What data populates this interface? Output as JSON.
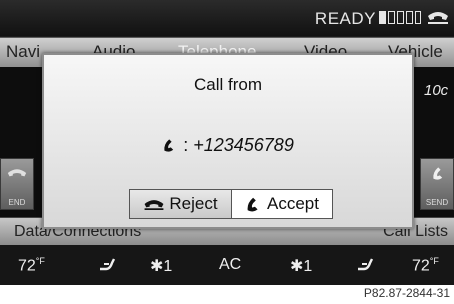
{
  "status": {
    "ready_text": "READY",
    "signal_bars_filled": 1,
    "signal_bars_total": 5
  },
  "menu": {
    "items": [
      "Navi",
      "Audio",
      "Telephone",
      "Video",
      "Vehicle"
    ]
  },
  "side": {
    "right_speed_fragment": "10c",
    "left_button_label": "END",
    "right_button_label": "SEND"
  },
  "bottom": {
    "left_label": "Data/Connections",
    "right_label": "Call Lists"
  },
  "climate": {
    "left_temp": "72",
    "left_unit": "°F",
    "left_fan": "1",
    "ac": "AC",
    "right_fan": "1",
    "right_temp": "72",
    "right_unit": "°F"
  },
  "dialog": {
    "title": "Call from",
    "caller_prefix": ":",
    "caller_number": "+123456789",
    "reject_label": "Reject",
    "accept_label": "Accept"
  },
  "caption": "P82.87-2844-31"
}
